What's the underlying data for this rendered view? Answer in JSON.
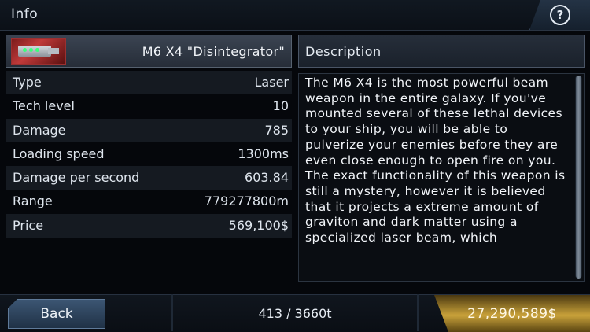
{
  "header": {
    "title": "Info",
    "help_icon": "question-icon",
    "help_glyph": "?"
  },
  "weapon": {
    "name": "M6 X4 \"Disintegrator\"",
    "icon": "laser-cannon-icon"
  },
  "stats": [
    {
      "label": "Type",
      "value": "Laser"
    },
    {
      "label": "Tech level",
      "value": "10"
    },
    {
      "label": "Damage",
      "value": "785"
    },
    {
      "label": "Loading speed",
      "value": "1300ms"
    },
    {
      "label": "Damage per second",
      "value": "603.84"
    },
    {
      "label": "Range",
      "value": "779277800m"
    },
    {
      "label": "Price",
      "value": "569,100$"
    }
  ],
  "description": {
    "header": "Description",
    "text": "The M6 X4 is the most powerful beam weapon in the entire galaxy. If you've mounted several of these lethal devices to your ship, you will be able to pulverize your enemies before they are even close enough to open fire on you. The exact functionality of this weapon is still a mystery, however it is believed that it projects a extreme amount of graviton and dark matter using a specialized laser beam, which"
  },
  "footer": {
    "back_label": "Back",
    "cargo": "413 / 3660t",
    "money": "27,290,589$"
  },
  "colors": {
    "accent_gold": "#c9a23a",
    "button_blue": "#3c5673"
  }
}
